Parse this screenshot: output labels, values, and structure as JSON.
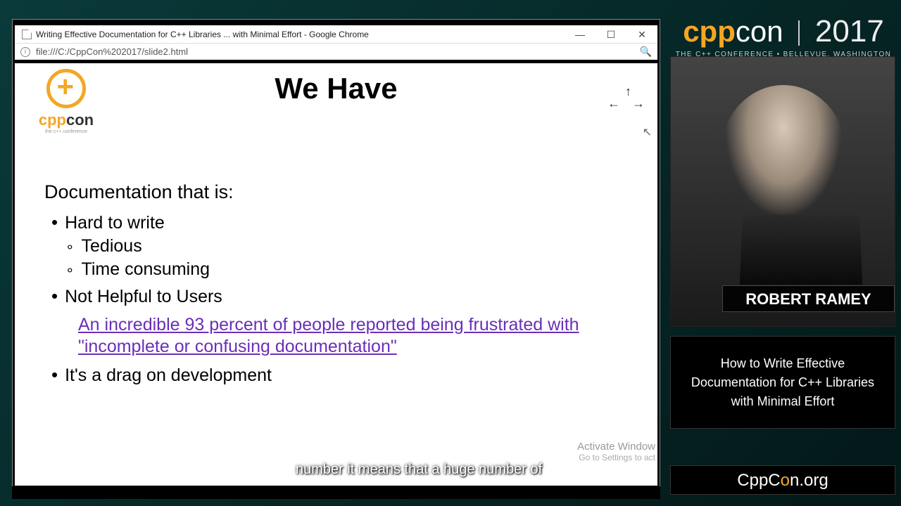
{
  "browser": {
    "title": "Writing Effective Documentation for C++ Libraries ... with Minimal Effort - Google Chrome",
    "url": "file:///C:/CppCon%202017/slide2.html"
  },
  "slide": {
    "title": "We Have",
    "intro": "Documentation that is:",
    "bullets": {
      "b1": "Hard to write",
      "b1a": "Tedious",
      "b1b": "Time consuming",
      "b2": "Not Helpful to Users",
      "b2link": "An incredible 93 percent of people reported being frustrated with \"incomplete or confusing documentation\"",
      "b3": "It's a drag on development"
    },
    "watermark": "Activate Window",
    "watermark_sub": "Go to Settings to act"
  },
  "logo": {
    "cpp": "cpp",
    "con": "con",
    "sub": "the c++ conference"
  },
  "conference": {
    "cpp": "cpp",
    "con": "con",
    "year": "2017",
    "sub": "THE C++ CONFERENCE • BELLEVUE, WASHINGTON"
  },
  "speaker": {
    "name": "ROBERT RAMEY"
  },
  "talk": {
    "title": "How to Write Effective Documentation for C++ Libraries with Minimal Effort"
  },
  "site": {
    "prefix": "CppC",
    "o": "o",
    "suffix": "n.org"
  },
  "caption": "number it means that a huge number of"
}
